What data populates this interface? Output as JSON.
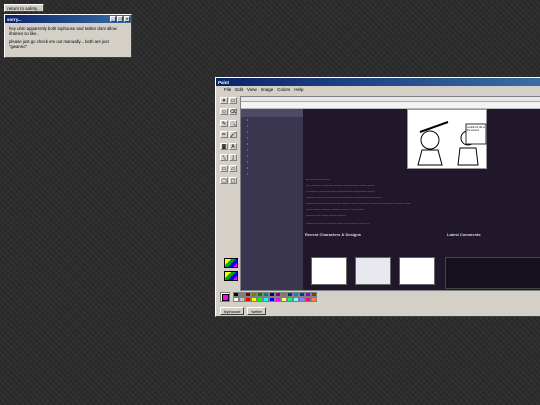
{
  "return_button": {
    "label": "return to safety..."
  },
  "sorry_window": {
    "title": "sorry...",
    "line1": "hey uhm apparently both tophouse and twitter dont allow iframes so like..",
    "line2": "please just go check em out manually... both are just \"gwanno\""
  },
  "paint": {
    "title": "Paint",
    "menu": [
      "File",
      "Edit",
      "View",
      "Image",
      "Colors",
      "Help"
    ],
    "tools": [
      "✦",
      "▭",
      "◇",
      "⌫",
      "✎",
      "🔍",
      "✏",
      "🖌",
      "▓",
      "A",
      "╲",
      "∫",
      "▭",
      "▱",
      "◯",
      "▢"
    ],
    "colors": {
      "row1": [
        "#000000",
        "#808080",
        "#800000",
        "#808000",
        "#008000",
        "#008080",
        "#000080",
        "#800080",
        "#808040",
        "#004040",
        "#0080ff",
        "#004080",
        "#8000ff",
        "#804000"
      ],
      "row2": [
        "#ffffff",
        "#c0c0c0",
        "#ff0000",
        "#ffff00",
        "#00ff00",
        "#00ffff",
        "#0000ff",
        "#ff00ff",
        "#ffff80",
        "#00ff80",
        "#80ffff",
        "#8080ff",
        "#ff0080",
        "#ff8040"
      ]
    },
    "tabs": [
      "tophouse",
      "twitter"
    ]
  },
  "site": {
    "sections": {
      "characters": "Recent Characters & Designs",
      "comments": "Latest Comments"
    },
    "art_caption": "i couldnt fit life in this screen!"
  }
}
